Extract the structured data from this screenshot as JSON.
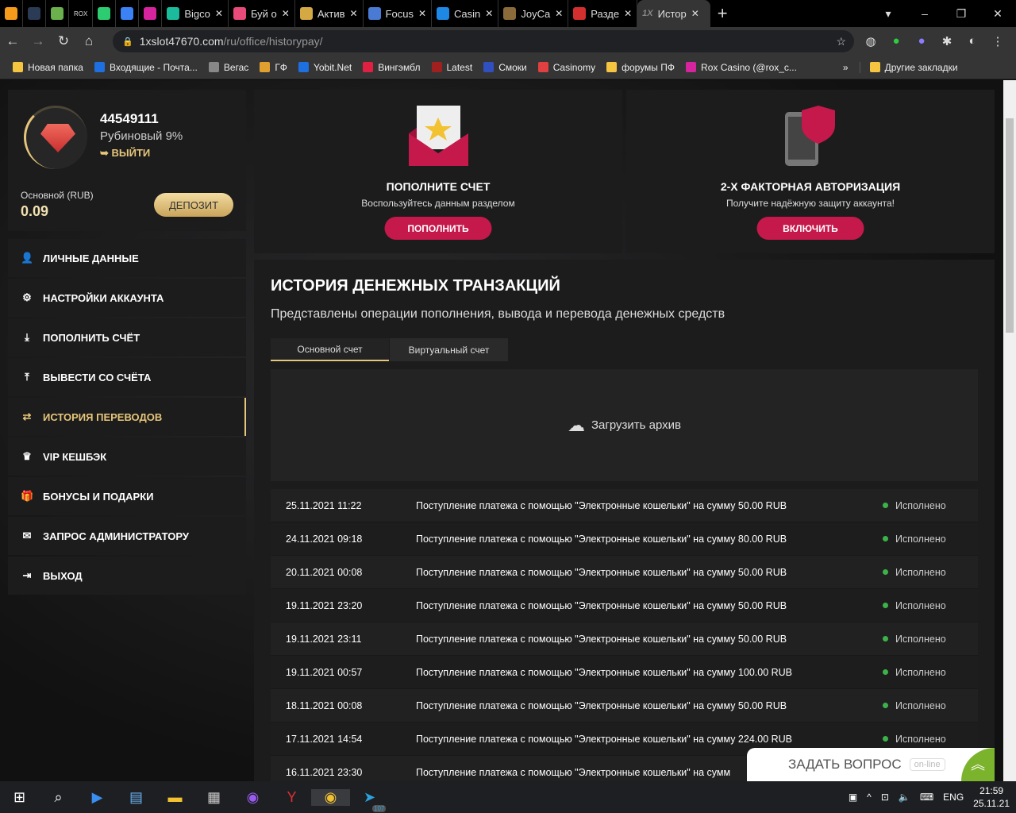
{
  "browser": {
    "tabs": [
      {
        "label": "",
        "color": "#f59a1b"
      },
      {
        "label": "",
        "color": "#2b3a55"
      },
      {
        "label": "",
        "color": "#6ab04c"
      },
      {
        "label": "ROX",
        "color": "#222"
      },
      {
        "label": "",
        "color": "#2ecc71"
      },
      {
        "label": "",
        "color": "#3b82f6"
      },
      {
        "label": "",
        "color": "#d6249f"
      },
      {
        "label": "Bigco",
        "color": "#1abc9c"
      },
      {
        "label": "Буй о",
        "color": "#e84a7a"
      },
      {
        "label": "Актив",
        "color": "#d4a843"
      },
      {
        "label": "Focus",
        "color": "#4a7bd4"
      },
      {
        "label": "Casin",
        "color": "#1e88e5"
      },
      {
        "label": "JoyCa",
        "color": "#8a6a3a"
      },
      {
        "label": "Разде",
        "color": "#d32f2f"
      }
    ],
    "active_tab": "Истор",
    "url_host": "1xslot47670.com",
    "url_path": "/ru/office/historypay/",
    "bookmarks": [
      {
        "label": "Новая папка",
        "color": "#f5c542"
      },
      {
        "label": "Входящие - Почта...",
        "color": "#1e6fe0"
      },
      {
        "label": "Вегас",
        "color": "#888"
      },
      {
        "label": "ГФ",
        "color": "#e0a030"
      },
      {
        "label": "Yobit.Net",
        "color": "#1e6fe0"
      },
      {
        "label": "Вингэмбл",
        "color": "#e02040"
      },
      {
        "label": "Latest",
        "color": "#a02020"
      },
      {
        "label": "Смоки",
        "color": "#3050c0"
      },
      {
        "label": "Casinomy",
        "color": "#e04040"
      },
      {
        "label": "форумы ПФ",
        "color": "#f5c542"
      },
      {
        "label": "Rox Casino (@rox_c...",
        "color": "#d6249f"
      }
    ],
    "more": "»",
    "other_bookmarks": "Другие закладки"
  },
  "profile": {
    "id": "44549111",
    "level": "Рубиновый 9%",
    "logout": "ВЫЙТИ",
    "balance_label": "Основной (RUB)",
    "balance": "0.09",
    "deposit": "ДЕПОЗИТ"
  },
  "menu": [
    {
      "label": "ЛИЧНЫЕ ДАННЫЕ",
      "icon": "user-add-icon",
      "glyph": "👤"
    },
    {
      "label": "НАСТРОЙКИ АККАУНТА",
      "icon": "gears-icon",
      "glyph": "⚙"
    },
    {
      "label": "ПОПОЛНИТЬ СЧЁТ",
      "icon": "download-icon",
      "glyph": "⤓"
    },
    {
      "label": "ВЫВЕСТИ СО СЧЁТА",
      "icon": "upload-icon",
      "glyph": "⤒"
    },
    {
      "label": "ИСТОРИЯ ПЕРЕВОДОВ",
      "icon": "transfer-icon",
      "glyph": "⇄"
    },
    {
      "label": "VIP КЕШБЭК",
      "icon": "crown-icon",
      "glyph": "♛"
    },
    {
      "label": "БОНУСЫ И ПОДАРКИ",
      "icon": "gift-icon",
      "glyph": "🎁"
    },
    {
      "label": "ЗАПРОС АДМИНИСТРАТОРУ",
      "icon": "envelope-icon",
      "glyph": "✉"
    },
    {
      "label": "ВЫХОД",
      "icon": "logout-icon",
      "glyph": "⇥"
    }
  ],
  "promos": [
    {
      "title": "ПОПОЛНИТЕ СЧЕТ",
      "text": "Воспользуйтесь данным разделом",
      "button": "ПОПОЛНИТЬ"
    },
    {
      "title": "2-Х ФАКТОРНАЯ АВТОРИЗАЦИЯ",
      "text": "Получите надёжную защиту аккаунта!",
      "button": "ВКЛЮЧИТЬ"
    }
  ],
  "history": {
    "title": "ИСТОРИЯ ДЕНЕЖНЫХ ТРАНЗАКЦИЙ",
    "subtitle": "Представлены операции пополнения, вывода и перевода денежных средств",
    "tabs": [
      "Основной счет",
      "Виртуальный счет"
    ],
    "upload": "Загрузить архив",
    "rows": [
      {
        "date": "25.11.2021 11:22",
        "text": "Поступление платежа с помощью \"Электронные кошельки\" на сумму 50.00 RUB",
        "status": "Исполнено"
      },
      {
        "date": "24.11.2021 09:18",
        "text": "Поступление платежа с помощью \"Электронные кошельки\" на сумму 80.00 RUB",
        "status": "Исполнено"
      },
      {
        "date": "20.11.2021 00:08",
        "text": "Поступление платежа с помощью \"Электронные кошельки\" на сумму 50.00 RUB",
        "status": "Исполнено"
      },
      {
        "date": "19.11.2021 23:20",
        "text": "Поступление платежа с помощью \"Электронные кошельки\" на сумму 50.00 RUB",
        "status": "Исполнено"
      },
      {
        "date": "19.11.2021 23:11",
        "text": "Поступление платежа с помощью \"Электронные кошельки\" на сумму 50.00 RUB",
        "status": "Исполнено"
      },
      {
        "date": "19.11.2021 00:57",
        "text": "Поступление платежа с помощью \"Электронные кошельки\" на сумму 100.00 RUB",
        "status": "Исполнено"
      },
      {
        "date": "18.11.2021 00:08",
        "text": "Поступление платежа с помощью \"Электронные кошельки\" на сумму 50.00 RUB",
        "status": "Исполнено"
      },
      {
        "date": "17.11.2021 14:54",
        "text": "Поступление платежа с помощью \"Электронные кошельки\" на сумму 224.00 RUB",
        "status": "Исполнено"
      },
      {
        "date": "16.11.2021 23:30",
        "text": "Поступление платежа с помощью \"Электронные кошельки\" на сумм",
        "status": ""
      }
    ]
  },
  "chat": {
    "label": "ЗАДАТЬ ВОПРОС",
    "status": "on-line"
  },
  "taskbar": {
    "lang": "ENG",
    "time": "21:59",
    "date": "25.11.21",
    "badge": "107"
  }
}
